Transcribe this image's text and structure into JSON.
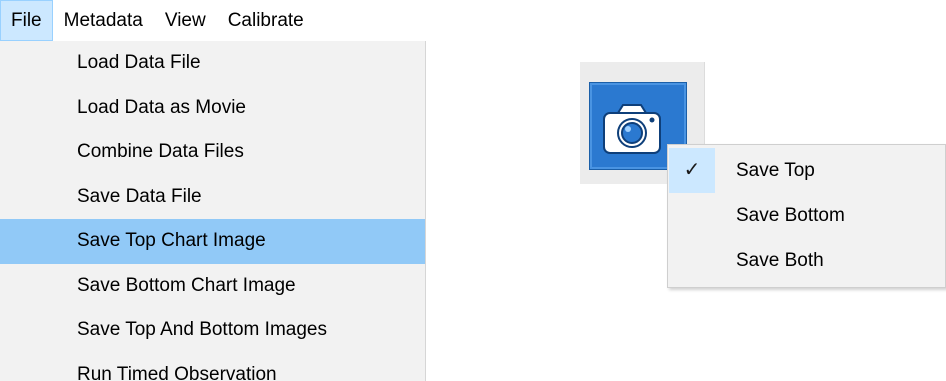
{
  "menubar": {
    "items": [
      {
        "label": "File",
        "active": true
      },
      {
        "label": "Metadata"
      },
      {
        "label": "View"
      },
      {
        "label": "Calibrate"
      }
    ]
  },
  "file_menu": {
    "items": [
      {
        "label": "Load Data File"
      },
      {
        "label": "Load Data as Movie"
      },
      {
        "label": "Combine Data Files"
      },
      {
        "label": "Save Data File"
      },
      {
        "label": "Save Top Chart Image",
        "highlighted": true
      },
      {
        "label": "Save Bottom Chart Image"
      },
      {
        "label": "Save Top And Bottom Images"
      },
      {
        "label": "Run Timed Observation"
      }
    ]
  },
  "camera_button": {
    "icon": "camera-icon"
  },
  "context_menu": {
    "check_glyph": "✓",
    "items": [
      {
        "label": "Save Top",
        "checked": true
      },
      {
        "label": "Save Bottom"
      },
      {
        "label": "Save Both"
      }
    ]
  },
  "colors": {
    "menu_highlight": "#91c9f7",
    "active_menu": "#cce8ff",
    "camera_blue": "#2b79d0"
  }
}
